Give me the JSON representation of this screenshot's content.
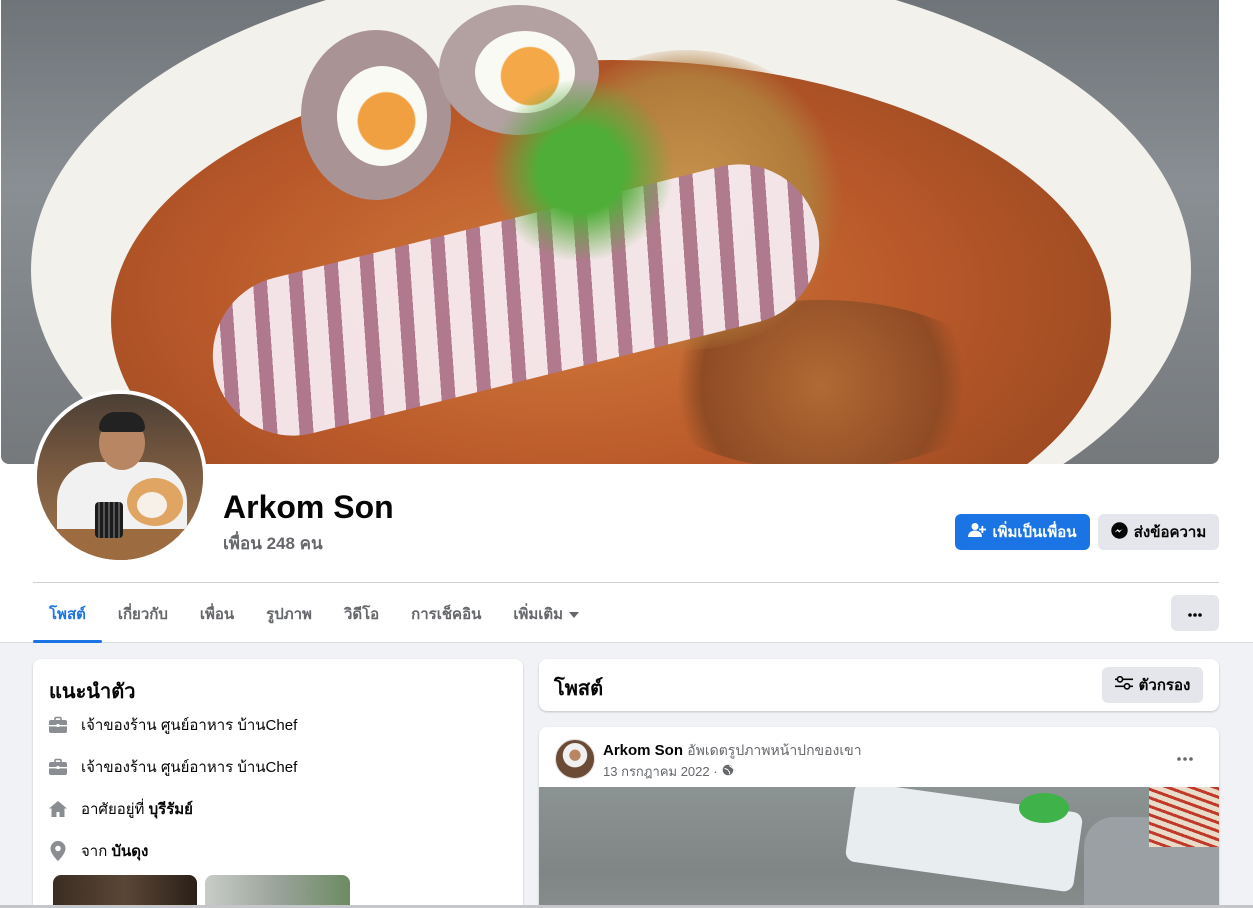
{
  "profile": {
    "name": "Arkom Son",
    "friend_count": "เพื่อน 248 คน"
  },
  "actions": {
    "add_friend": "เพิ่มเป็นเพื่อน",
    "message": "ส่งข้อความ"
  },
  "tabs": [
    {
      "label": "โพสต์",
      "active": true
    },
    {
      "label": "เกี่ยวกับ"
    },
    {
      "label": "เพื่อน"
    },
    {
      "label": "รูปภาพ"
    },
    {
      "label": "วิดีโอ"
    },
    {
      "label": "การเช็คอิน"
    },
    {
      "label": "เพิ่มเติม"
    }
  ],
  "intro": {
    "title": "แนะนำตัว",
    "items": [
      {
        "icon": "briefcase-icon",
        "text": "เจ้าของร้าน ศูนย์อาหาร บ้านChef"
      },
      {
        "icon": "briefcase-icon",
        "text": "เจ้าของร้าน ศูนย์อาหาร บ้านChef"
      },
      {
        "icon": "home-icon",
        "prefix": "อาศัยอยู่ที่ ",
        "bold": "บุรีรัมย์"
      },
      {
        "icon": "location-pin-icon",
        "prefix": "จาก ",
        "bold": "บันดุง"
      }
    ]
  },
  "posts": {
    "title": "โพสต์",
    "filter_label": "ตัวกรอง"
  },
  "post": {
    "author": "Arkom Son",
    "action": "อัพเดตรูปภาพหน้าปกของเขา",
    "date": "13 กรกฎาคม 2022 ·",
    "privacy_icon": "globe-icon"
  },
  "colors": {
    "accent": "#1b74e4",
    "secondary_button": "#e4e6eb",
    "muted_text": "#65676b"
  }
}
